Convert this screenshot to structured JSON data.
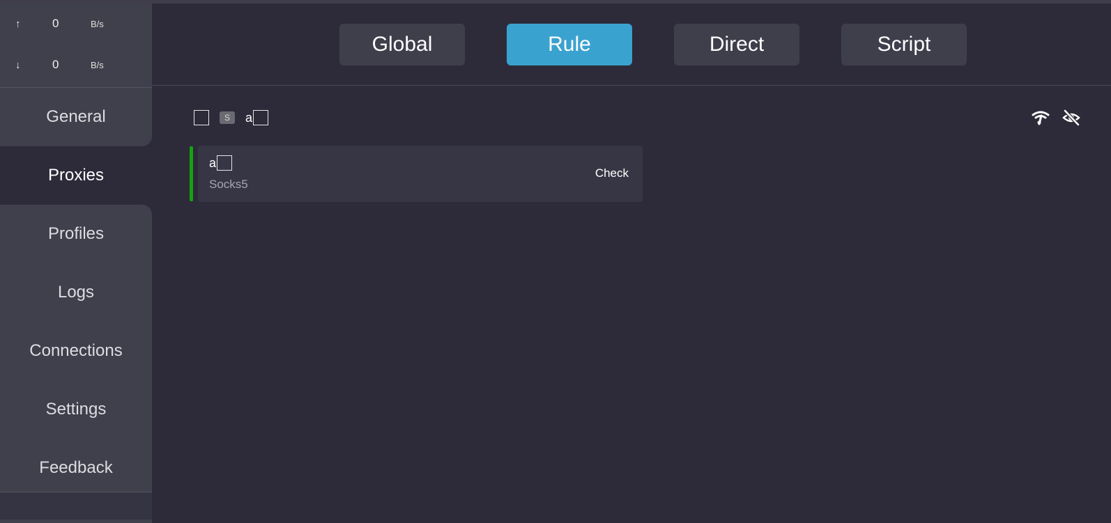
{
  "traffic": {
    "up_arrow": "↑",
    "up_value": "0",
    "up_unit": "B/s",
    "down_arrow": "↓",
    "down_value": "0",
    "down_unit": "B/s"
  },
  "sidebar": {
    "items": [
      {
        "label": "General"
      },
      {
        "label": "Proxies",
        "active": true
      },
      {
        "label": "Profiles"
      },
      {
        "label": "Logs"
      },
      {
        "label": "Connections"
      },
      {
        "label": "Settings"
      },
      {
        "label": "Feedback"
      }
    ]
  },
  "modes": {
    "items": [
      {
        "label": "Global"
      },
      {
        "label": "Rule",
        "active": true
      },
      {
        "label": "Direct"
      },
      {
        "label": "Script"
      }
    ]
  },
  "group": {
    "tag": "S",
    "name": "a"
  },
  "toolbar_icons": {
    "latency_icon": "wifi-speed-icon",
    "hide_icon": "eye-off-icon"
  },
  "proxy": {
    "name": "a",
    "type": "Socks5",
    "action": "Check",
    "status_color": "#14a30f"
  },
  "colors": {
    "accent": "#3aa2cf",
    "background": "#2d2b3a",
    "sidebar": "#40404c"
  }
}
